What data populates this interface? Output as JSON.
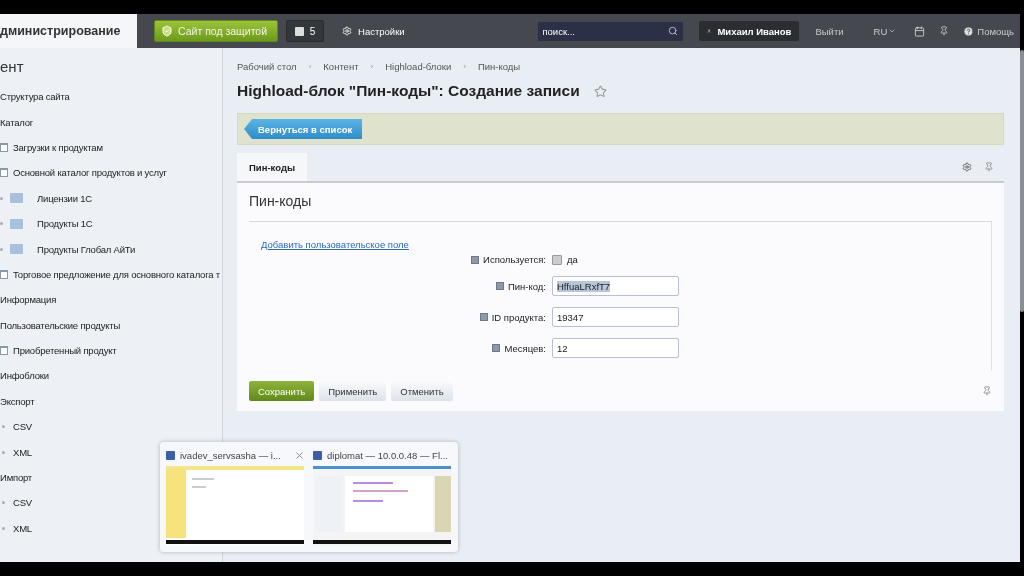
{
  "top_bar": {
    "admin_tab": {
      "label": "дминистрирование",
      "selected": true
    },
    "protection_button": "Сайт под защитой",
    "notifications_count": "5",
    "settings": "Настройки",
    "search": {
      "placeholder": "поиск..."
    },
    "user": "Михаил Иванов",
    "logout": "Выйти",
    "language": "RU",
    "help": "Помощь"
  },
  "sidebar": {
    "title": "ент",
    "items": [
      {
        "label": "Структура сайта",
        "kind": "section"
      },
      {
        "label": "Каталог",
        "kind": "section",
        "children": [
          {
            "label": "Загрузки к продуктам",
            "kind": "page"
          },
          {
            "label": "Основной каталог продуктов и услуг",
            "kind": "page",
            "children": [
              {
                "label": "Лицензии 1С",
                "kind": "folder"
              },
              {
                "label": "Продукты 1С",
                "kind": "folder"
              },
              {
                "label": "Продукты Глобал АйТи",
                "kind": "folder"
              }
            ]
          },
          {
            "label": "Торговое предложение для основного каталога т",
            "kind": "page"
          }
        ]
      },
      {
        "label": "Информация",
        "kind": "section"
      },
      {
        "label": "Пользовательские продукты",
        "kind": "section",
        "children": [
          {
            "label": "Приобретенный продукт",
            "kind": "page"
          }
        ]
      },
      {
        "label": "Инфоблоки",
        "kind": "section"
      },
      {
        "label": "Экспорт",
        "kind": "section",
        "children": [
          {
            "label": "CSV",
            "kind": "bullet"
          },
          {
            "label": "XML",
            "kind": "bullet"
          }
        ]
      },
      {
        "label": "Импорт",
        "kind": "section",
        "children": [
          {
            "label": "CSV",
            "kind": "bullet"
          },
          {
            "label": "XML",
            "kind": "bullet"
          }
        ]
      }
    ]
  },
  "breadcrumbs": [
    {
      "label": "Рабочий стол"
    },
    {
      "separator": "›",
      "label": "Контент"
    },
    {
      "separator": "›",
      "label": "Highload-блоки"
    },
    {
      "separator": "›",
      "label": "Пин-коды"
    }
  ],
  "page_title": "Highload-блок \"Пин-коды\": Создание записи",
  "toolbar": {
    "back_button": "Вернуться в список"
  },
  "tabs": [
    {
      "label": "Пин-коды",
      "selected": true
    }
  ],
  "form": {
    "title": "Пин-коды",
    "add_field_link": "Добавить пользовательское поле",
    "fields": [
      {
        "kind": "checkbox",
        "label": "Используется:",
        "option": "да",
        "checked": false
      },
      {
        "kind": "text",
        "label": "Пин-код:",
        "value": "HffuaLRxfT7",
        "text_selected": true
      },
      {
        "kind": "text",
        "label": "ID продукта:",
        "value": "19347",
        "text_selected": false
      },
      {
        "kind": "text",
        "label": "Месяцев:",
        "value": "12",
        "text_selected": false
      }
    ]
  },
  "buttons": [
    {
      "label": "Сохранить",
      "kind": "primary"
    },
    {
      "label": "Применить",
      "kind": "secondary"
    },
    {
      "label": "Отменить",
      "kind": "secondary"
    }
  ],
  "taskbar_preview": {
    "windows": [
      {
        "title": "ivadev_servsasha — i...",
        "closable": true,
        "kind": "light"
      },
      {
        "title": "diplomat — 10.0.0.48 — Fl...",
        "closable": false,
        "kind": "code"
      }
    ]
  }
}
